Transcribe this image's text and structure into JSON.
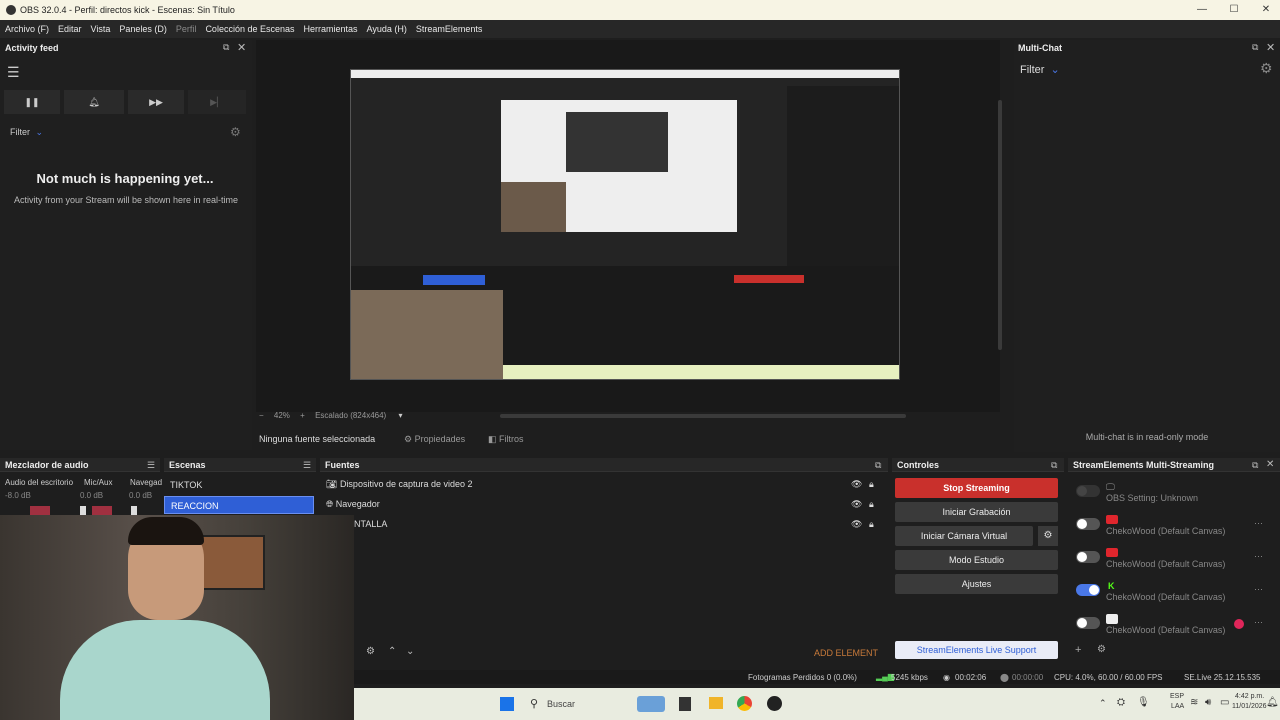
{
  "window": {
    "title": "OBS 32.0.4 - Perfil: directos kick - Escenas: Sin Título"
  },
  "menu": [
    "Archivo (F)",
    "Editar",
    "Vista",
    "Paneles (D)",
    "Perfil",
    "Colección de Escenas",
    "Herramientas",
    "Ayuda (H)",
    "StreamElements"
  ],
  "activity_feed": {
    "title": "Activity feed",
    "filter": "Filter",
    "empty_title": "Not much is happening yet...",
    "empty_sub": "Activity from your Stream will be shown here in real-time"
  },
  "preview": {
    "zoom": "42%",
    "scale": "Escalado (824x464)"
  },
  "source_bar": {
    "none_selected": "Ninguna fuente seleccionada",
    "properties": "Propiedades",
    "filters": "Filtros"
  },
  "multichat": {
    "title": "Multi-Chat",
    "filter": "Filter",
    "readonly": "Multi-chat is in read-only mode"
  },
  "mixer": {
    "title": "Mezclador de audio",
    "channels": [
      {
        "name": "Audio del escritorio",
        "db": "-8.0 dB"
      },
      {
        "name": "Mic/Aux",
        "db": "0.0 dB"
      },
      {
        "name": "Navegad",
        "db": "0.0 dB"
      }
    ]
  },
  "scenes": {
    "title": "Escenas",
    "items": [
      "TIKTOK",
      "REACCION"
    ],
    "selected": 1
  },
  "sources": {
    "title": "Fuentes",
    "items": [
      "Dispositivo de captura de video 2",
      "Navegador",
      "NTALLA"
    ],
    "add_element": "ADD ELEMENT"
  },
  "controls": {
    "title": "Controles",
    "stop_streaming": "Stop Streaming",
    "record": "Iniciar Grabación",
    "virtual_cam": "Iniciar Cámara Virtual",
    "studio": "Modo Estudio",
    "settings": "Ajustes",
    "live_support": "StreamElements Live Support"
  },
  "multistream": {
    "title": "StreamElements Multi-Streaming",
    "rows": [
      {
        "label": "OBS Setting: Unknown"
      },
      {
        "label": "ChekoWood (Default Canvas)",
        "enabled": false
      },
      {
        "label": "ChekoWood (Default Canvas)",
        "enabled": false
      },
      {
        "label": "ChekoWood (Default Canvas)",
        "enabled": true
      },
      {
        "label": "ChekoWood (Default Canvas)",
        "enabled": false
      }
    ]
  },
  "status": {
    "dropped": "Fotogramas Perdidos 0 (0.0%)",
    "bitrate": "5245 kbps",
    "stream_time": "00:02:06",
    "rec_time": "00:00:00",
    "cpu": "CPU: 4.0%, 60.00 / 60.00 FPS",
    "se": "SE.Live 25.12.15.535"
  },
  "taskbar": {
    "search": "Buscar",
    "lang1": "ESP",
    "lang2": "LAA",
    "time": "4:42 p.m.",
    "date": "11/01/2026"
  },
  "colors": {
    "accent": "#4a78e8",
    "stop": "#c9302c",
    "selected": "#2f5fd6"
  }
}
